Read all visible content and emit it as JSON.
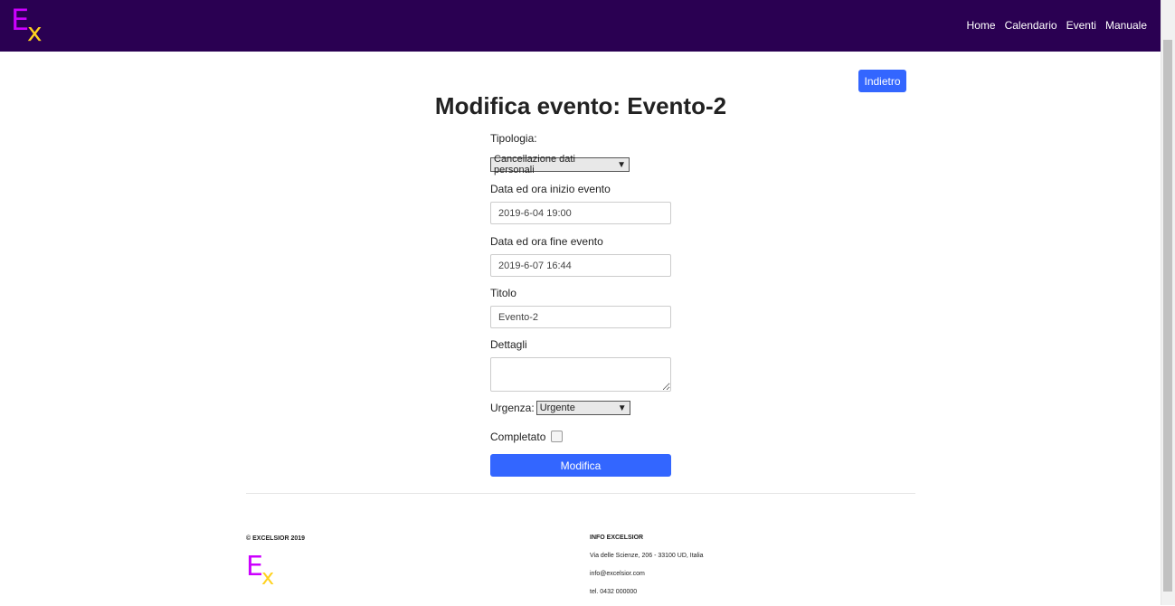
{
  "brand": {
    "logo_big": "E",
    "logo_small": "x"
  },
  "nav": [
    "Home",
    "Calendario",
    "Eventi",
    "Manuale"
  ],
  "back_button": "Indietro",
  "page_title": "Modifica evento: Evento-2",
  "form": {
    "type_label": "Tipologia:",
    "type_value": "Cancellazione dati personali",
    "start_label": "Data ed ora inizio evento",
    "start_value": "2019-6-04 19:00",
    "end_label": "Data ed ora fine evento",
    "end_value": "2019-6-07 16:44",
    "title_label": "Titolo",
    "title_value": "Evento-2",
    "details_label": "Dettagli",
    "details_value": "",
    "urgency_label": "Urgenza:",
    "urgency_value": "Urgente",
    "completed_label": "Completato",
    "completed": false,
    "submit_label": "Modifica"
  },
  "footer": {
    "copyright": "© EXCELSIOR 2019",
    "info_heading": "INFO EXCELSIOR",
    "address": "Via delle Scienze, 206 - 33100 UD, Italia",
    "email": "info@excelsior.com",
    "phone": "tel. 0432 000000"
  },
  "colors": {
    "navbar": "#2a0052",
    "accent": "#3366ff",
    "logo_e": "#cc00ff",
    "logo_x": "#ffd21f"
  }
}
